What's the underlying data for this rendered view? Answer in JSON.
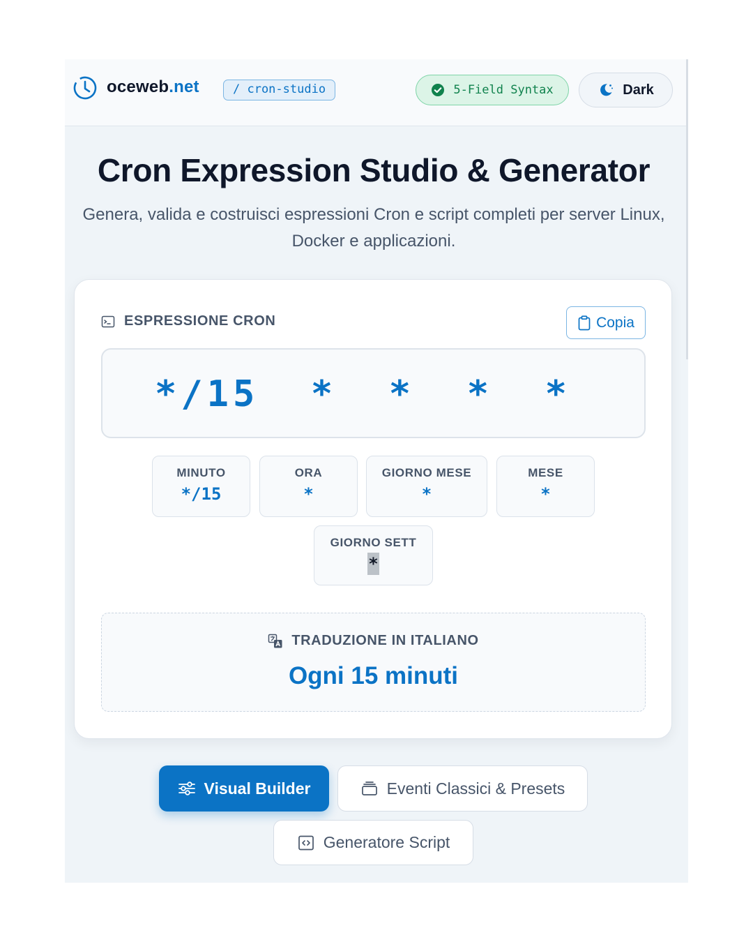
{
  "header": {
    "brand_name": "oceweb",
    "brand_tld": ".net",
    "path_badge": "/ cron-studio",
    "syntax_pill": "5-Field Syntax",
    "theme_button": "Dark",
    "icons": {
      "logo": "clock-icon",
      "syntax": "check-circle-icon",
      "theme": "moon-icon"
    }
  },
  "hero": {
    "title": "Cron Expression Studio & Generator",
    "subtitle": "Genera, valida e costruisci espressioni Cron e script completi per server Linux, Docker e applicazioni."
  },
  "expression_card": {
    "section_label": "ESPRESSIONE CRON",
    "copy_button": "Copia",
    "expression": "*/15  *  *  *  *",
    "fields": [
      {
        "label": "MINUTO",
        "value": "*/15"
      },
      {
        "label": "ORA",
        "value": "*"
      },
      {
        "label": "GIORNO MESE",
        "value": "*"
      },
      {
        "label": "MESE",
        "value": "*"
      },
      {
        "label": "GIORNO SETT",
        "value": "*"
      }
    ],
    "translation": {
      "label": "TRADUZIONE IN ITALIANO",
      "value": "Ogni 15 minuti"
    }
  },
  "tabs": [
    {
      "label": "Visual Builder",
      "active": true,
      "icon": "sliders-icon"
    },
    {
      "label": "Eventi Classici & Presets",
      "active": false,
      "icon": "archive-icon"
    },
    {
      "label": "Generatore Script",
      "active": false,
      "icon": "code-file-icon"
    }
  ],
  "colors": {
    "accent": "#0b73c5",
    "success": "#10824d",
    "text": "#0f172a",
    "muted": "#475569",
    "background": "#eff4f8"
  }
}
